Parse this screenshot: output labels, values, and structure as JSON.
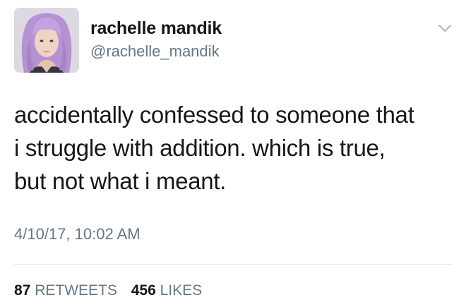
{
  "author": {
    "name": "rachelle mandik",
    "handle": "@rachelle_mandik",
    "avatar_icon": "user-avatar-photo"
  },
  "menu": {
    "icon": "chevron-down-icon"
  },
  "tweet": {
    "lines": [
      "accidentally confessed to someone that",
      "i struggle with addition. which is true,",
      "but not what i meant."
    ],
    "timestamp": "4/10/17, 10:02 AM"
  },
  "stats": {
    "retweets_count": "87",
    "retweets_label": "RETWEETS",
    "likes_count": "456",
    "likes_label": "LIKES"
  },
  "colors": {
    "text_primary": "#14171a",
    "text_secondary": "#657786",
    "divider": "#e1e8ed",
    "hair": "#b48fcf"
  }
}
